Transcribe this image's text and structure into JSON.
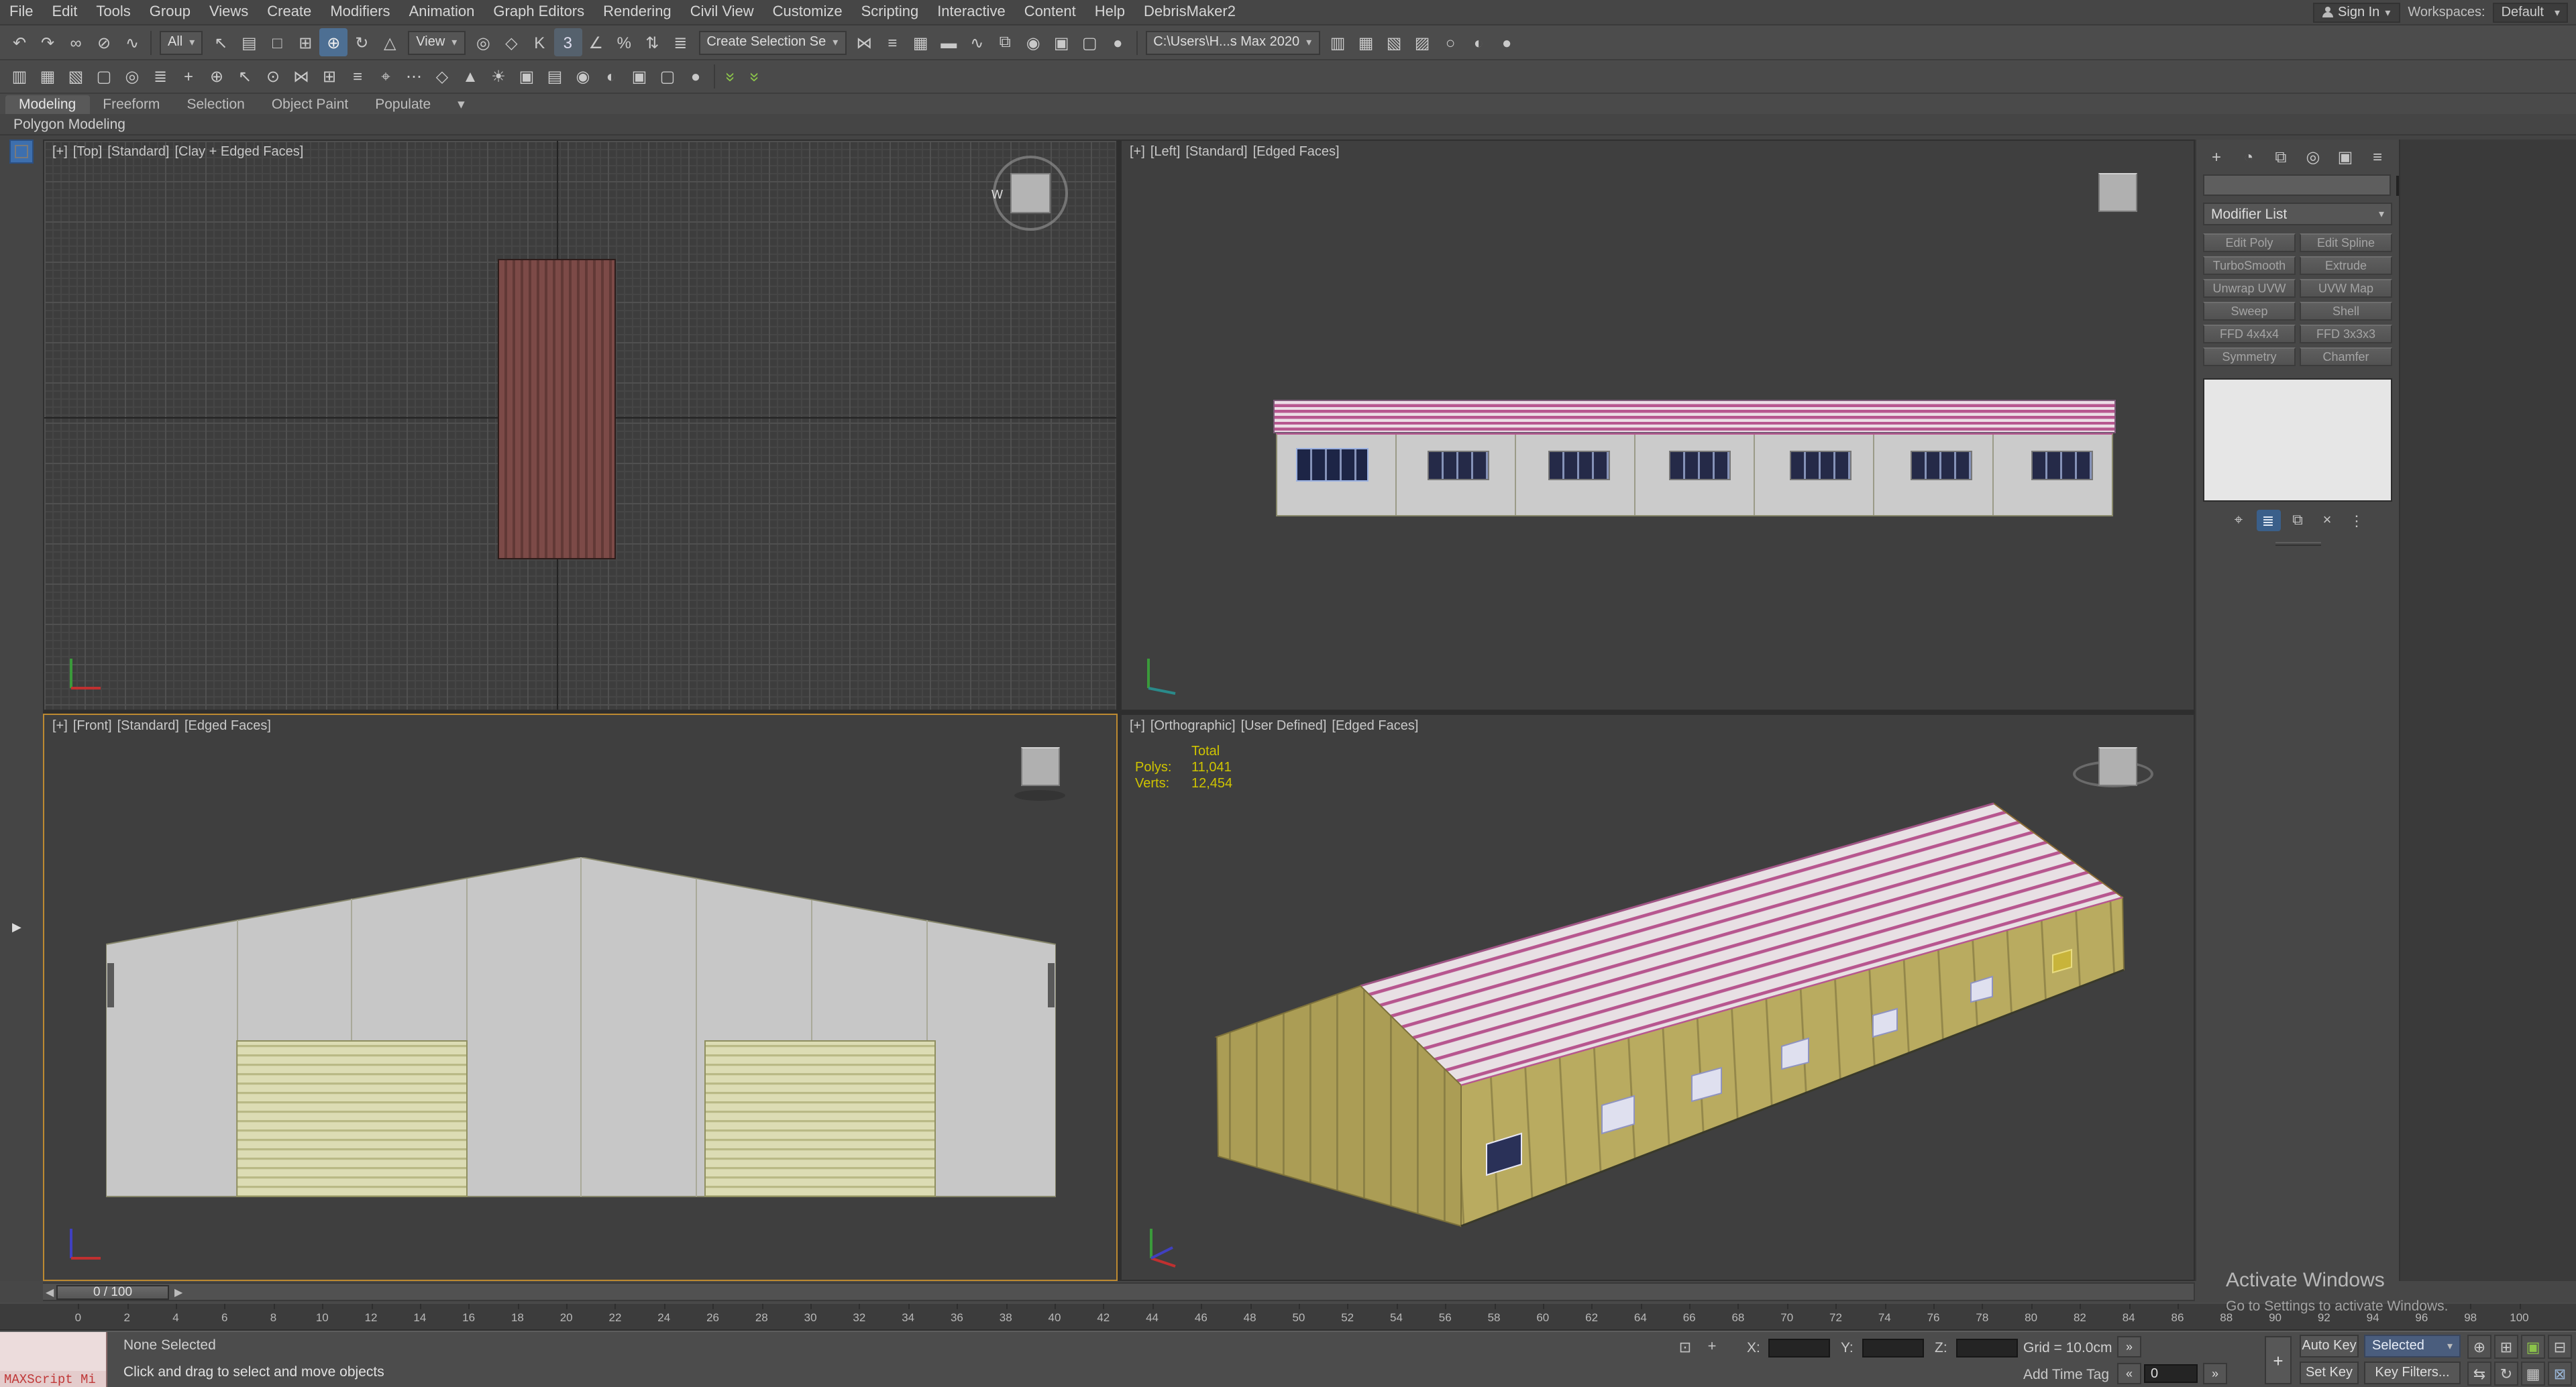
{
  "menu_bar": {
    "items": [
      "File",
      "Edit",
      "Tools",
      "Group",
      "Views",
      "Create",
      "Modifiers",
      "Animation",
      "Graph Editors",
      "Rendering",
      "Civil View",
      "Customize",
      "Scripting",
      "Interactive",
      "Content",
      "Help",
      "DebrisMaker2"
    ],
    "sign_in": "Sign In",
    "workspaces_label": "Workspaces:",
    "workspace_value": "Default"
  },
  "toolbar_row1": {
    "group_a": [
      {
        "n": "undo-icon",
        "g": "↶"
      },
      {
        "n": "redo-icon",
        "g": "↷"
      },
      {
        "n": "select-and-link-icon",
        "g": "∞"
      },
      {
        "n": "unlink-selection-icon",
        "g": "⊘"
      },
      {
        "n": "bind-to-space-warp-icon",
        "g": "∿"
      }
    ],
    "selection_filter": "All",
    "group_b": [
      {
        "n": "select-object-icon",
        "g": "↖"
      },
      {
        "n": "select-by-name-icon",
        "g": "▤"
      },
      {
        "n": "rectangular-selection-region-icon",
        "g": "□"
      },
      {
        "n": "window-crossing-icon",
        "g": "⊞"
      },
      {
        "n": "select-and-move-icon",
        "g": "⊕"
      },
      {
        "n": "select-and-rotate-icon",
        "g": "↻"
      },
      {
        "n": "select-and-scale-icon",
        "g": "△"
      }
    ],
    "ref_coord": "View",
    "group_c": [
      {
        "n": "use-pivot-center-icon",
        "g": "◎"
      },
      {
        "n": "select-and-manipulate-icon",
        "g": "◇"
      },
      {
        "n": "keyboard-override-icon",
        "g": "K"
      },
      {
        "n": "snap-toggle-icon",
        "g": "3"
      },
      {
        "n": "angle-snap-icon",
        "g": "∠"
      },
      {
        "n": "percent-snap-icon",
        "g": "%"
      },
      {
        "n": "spinner-snap-icon",
        "g": "⇅"
      },
      {
        "n": "edit-named-selection-sets-icon",
        "g": "≣"
      }
    ],
    "named_sets": "Create Selection Se",
    "group_d": [
      {
        "n": "mirror-icon",
        "g": "⋈"
      },
      {
        "n": "align-icon",
        "g": "≡"
      },
      {
        "n": "layer-manager-icon",
        "g": "▦"
      },
      {
        "n": "toggle-ribbon-icon",
        "g": "▬"
      },
      {
        "n": "curve-editor-icon",
        "g": "∿"
      },
      {
        "n": "schematic-view-icon",
        "g": "⧉"
      },
      {
        "n": "material-editor-icon",
        "g": "◉"
      },
      {
        "n": "render-setup-icon",
        "g": "▣"
      },
      {
        "n": "rendered-frame-window-icon",
        "g": "▢"
      },
      {
        "n": "render-production-icon",
        "g": "●"
      }
    ],
    "project_path": "C:\\Users\\H...s Max 2020",
    "group_e": [
      {
        "n": "scene-explorer-open-icon",
        "g": "▥"
      },
      {
        "n": "layer-explorer-open-icon",
        "g": "▦"
      },
      {
        "n": "container-explorer-icon",
        "g": "▧"
      },
      {
        "n": "saved-scene-explorer-icon",
        "g": "▨"
      },
      {
        "n": "activeshade-icon",
        "g": "○"
      },
      {
        "n": "render-iterative-icon",
        "g": "◐"
      },
      {
        "n": "render-last-icon",
        "g": "●"
      }
    ]
  },
  "toolbar_row2": {
    "icons": [
      {
        "n": "scene-explorer-icon",
        "g": "▥"
      },
      {
        "n": "layer-explorer-icon",
        "g": "▦"
      },
      {
        "n": "open-container-icon",
        "g": "▧"
      },
      {
        "n": "display-floater-icon",
        "g": "▢"
      },
      {
        "n": "isolate-selection-icon",
        "g": "◎"
      },
      {
        "n": "manage-layers-icon",
        "g": "≣"
      },
      {
        "n": "create-layer-icon",
        "g": "+"
      },
      {
        "n": "add-selection-to-layer-icon",
        "g": "⊕"
      },
      {
        "n": "select-objects-in-layer-icon",
        "g": "↖"
      },
      {
        "n": "set-current-layer-icon",
        "g": "⊙"
      },
      {
        "n": "mirror-tool-icon",
        "g": "⋈"
      },
      {
        "n": "array-tool-icon",
        "g": "⊞"
      },
      {
        "n": "align-tool-icon",
        "g": "≡"
      },
      {
        "n": "quick-align-icon",
        "g": "⌖"
      },
      {
        "n": "spacing-tool-icon",
        "g": "⋯"
      },
      {
        "n": "snapshot-icon",
        "g": "◇"
      },
      {
        "n": "normal-align-icon",
        "g": "▲"
      },
      {
        "n": "place-highlight-icon",
        "g": "☀"
      },
      {
        "n": "align-camera-icon",
        "g": "▣"
      },
      {
        "n": "align-to-view-icon",
        "g": "▤"
      },
      {
        "n": "material-editor-2-icon",
        "g": "◉"
      },
      {
        "n": "light-lister-icon",
        "g": "◐"
      },
      {
        "n": "render-setup-2-icon",
        "g": "▣"
      },
      {
        "n": "rendered-frame-2-icon",
        "g": "▢"
      },
      {
        "n": "quick-render-icon",
        "g": "●"
      }
    ],
    "chevron_glyph": "»"
  },
  "ribbon": {
    "tabs": [
      "Modeling",
      "Freeform",
      "Selection",
      "Object Paint",
      "Populate"
    ],
    "panel_label": "Polygon Modeling"
  },
  "viewports": {
    "top": {
      "segments": [
        "[+]",
        "[Top]",
        "[Standard]",
        "[Clay + Edged Faces]"
      ]
    },
    "left": {
      "segments": [
        "[+]",
        "[Left]",
        "[Standard]",
        "[Edged Faces]"
      ]
    },
    "front": {
      "segments": [
        "[+]",
        "[Front]",
        "[Standard]",
        "[Edged Faces]"
      ]
    },
    "ortho": {
      "segments": [
        "[+]",
        "[Orthographic]",
        "[User Defined]",
        "[Edged Faces]"
      ],
      "stats": {
        "title": "Total",
        "polys_label": "Polys:",
        "polys": "11,041",
        "verts_label": "Verts:",
        "verts": "12,454"
      }
    },
    "viewcube_west": "W"
  },
  "left_strip": {
    "icons": [
      {
        "n": "viewport-layout-tab-1-icon"
      },
      {
        "n": "viewport-layout-tab-2-icon"
      },
      {
        "n": "viewport-layout-tab-3-icon"
      },
      {
        "n": "viewport-layout-tab-4-icon"
      },
      {
        "n": "viewport-layout-active-icon"
      }
    ]
  },
  "command_panel": {
    "tabs": [
      {
        "n": "create-tab-icon",
        "g": "+"
      },
      {
        "n": "modify-tab-icon",
        "g": "◔"
      },
      {
        "n": "hierarchy-tab-icon",
        "g": "⧉"
      },
      {
        "n": "motion-tab-icon",
        "g": "◎"
      },
      {
        "n": "display-tab-icon",
        "g": "▣"
      },
      {
        "n": "utilities-tab-icon",
        "g": "≡"
      }
    ],
    "modifier_list_label": "Modifier List",
    "modifier_buttons": [
      "Edit Poly",
      "Edit Spline",
      "TurboSmooth",
      "Extrude",
      "Unwrap UVW",
      "UVW Map",
      "Sweep",
      "Shell",
      "FFD 4x4x4",
      "FFD 3x3x3",
      "Symmetry",
      "Chamfer"
    ],
    "stack_icons": [
      {
        "n": "pin-stack-icon",
        "g": "⌖"
      },
      {
        "n": "show-end-result-icon",
        "g": "≣"
      },
      {
        "n": "make-unique-icon",
        "g": "⧉"
      },
      {
        "n": "remove-modifier-icon",
        "g": "×"
      },
      {
        "n": "configure-modifier-sets-icon",
        "g": "⋮"
      }
    ]
  },
  "timeline": {
    "slider_value": "0 / 100",
    "ticks": [
      "0",
      "2",
      "4",
      "6",
      "8",
      "10",
      "12",
      "14",
      "16",
      "18",
      "20",
      "22",
      "24",
      "26",
      "28",
      "30",
      "32",
      "34",
      "36",
      "38",
      "40",
      "42",
      "44",
      "46",
      "48",
      "50",
      "52",
      "54",
      "56",
      "58",
      "60",
      "62",
      "64",
      "66",
      "68",
      "70",
      "72",
      "74",
      "76",
      "78",
      "80",
      "82",
      "84",
      "86",
      "88",
      "90",
      "92",
      "94",
      "96",
      "98",
      "100"
    ]
  },
  "status_bar": {
    "maxscript": "MAXScript Mi",
    "selection_status": "None Selected",
    "prompt": "Click and drag to select and move objects",
    "x_label": "X:",
    "y_label": "Y:",
    "z_label": "Z:",
    "grid_label": "Grid = 10.0cm",
    "add_time_tag": "Add Time Tag",
    "playback": [
      {
        "n": "go-to-start-button",
        "g": "«"
      },
      {
        "n": "previous-frame-button",
        "g": "‹"
      },
      {
        "n": "play-button",
        "g": "▶"
      },
      {
        "n": "next-frame-button",
        "g": "›"
      },
      {
        "n": "go-to-end-button",
        "g": "»"
      }
    ],
    "prev_key_glyph": "«",
    "next_key_glyph": "»",
    "frame_field": "0",
    "set_keys_glyph": "+",
    "auto_key": "Auto Key",
    "set_key": "Set Key",
    "selected_dropdown": "Selected",
    "key_filters": "Key Filters...",
    "nav_icons": [
      {
        "n": "zoom-icon",
        "g": "⊕"
      },
      {
        "n": "zoom-all-icon",
        "g": "⊞"
      },
      {
        "n": "zoom-extents-all-icon",
        "g": "▣"
      },
      {
        "n": "zoom-region-icon",
        "g": "⊟"
      },
      {
        "n": "pan-view-icon",
        "g": "⇆"
      },
      {
        "n": "orbit-icon",
        "g": "↻"
      },
      {
        "n": "viewport-config-icon",
        "g": "▦"
      },
      {
        "n": "maximize-viewport-toggle-icon",
        "g": "⊠"
      }
    ]
  },
  "watermark": {
    "line1": "Activate Windows",
    "line2": "Go to Settings to activate Windows."
  }
}
